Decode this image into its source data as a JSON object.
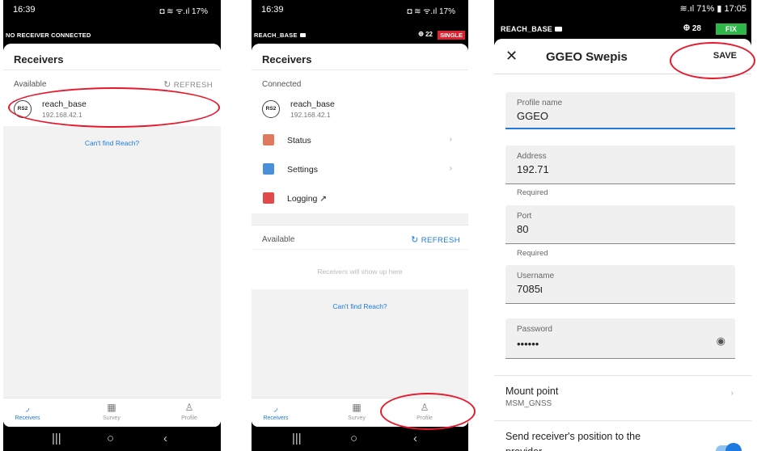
{
  "phone1": {
    "status_time": "16:39",
    "status_icons": "◘ ≋ ᯤ.ıl 17%",
    "connection": "NO RECEIVER CONNECTED",
    "header": "Receivers",
    "available_label": "Available",
    "refresh": "REFRESH",
    "receiver": {
      "badge": "RS2",
      "name": "reach_base",
      "ip": "192.168.42.1"
    },
    "cant_find": "Can't find Reach?",
    "tabs": [
      "Receivers",
      "Survey",
      "Profile"
    ]
  },
  "phone2": {
    "status_time": "16:39",
    "status_icons": "◘ ≋ ᯤ.ıl 17%",
    "connection": "REACH_BASE",
    "satellites": "22",
    "fix_status": "SINGLE",
    "fix_color": "#e0202c",
    "header": "Receivers",
    "connected_label": "Connected",
    "receiver": {
      "badge": "RS2",
      "name": "reach_base",
      "ip": "192.168.42.1"
    },
    "menu": [
      {
        "label": "Status",
        "color": "#e07a5f"
      },
      {
        "label": "Settings",
        "color": "#4a8fd9"
      },
      {
        "label": "Logging ↗",
        "color": "#e04a4a"
      }
    ],
    "available_label": "Available",
    "refresh": "REFRESH",
    "placeholder": "Receivers will show up here",
    "cant_find": "Can't find Reach?",
    "tabs": [
      "Receivers",
      "Survey",
      "Profile"
    ]
  },
  "phone3": {
    "status_icons": "≋.ıl 71% ▮ 17:05",
    "connection": "REACH_BASE",
    "satellites": "28",
    "fix_status": "FIX",
    "fix_color": "#2fb84a",
    "title": "GGEO Swepis",
    "save": "SAVE",
    "fields": {
      "profile_name_label": "Profile name",
      "profile_name_value": "GGEO",
      "address_label": "Address",
      "address_value": "192.71",
      "address_helper": "Required",
      "port_label": "Port",
      "port_value": "80",
      "port_helper": "Required",
      "username_label": "Username",
      "username_value": "7085ι",
      "password_label": "Password",
      "password_value": "••••••"
    },
    "mount_point_label": "Mount point",
    "mount_point_value": "MSM_GNSS",
    "send_position_label": "Send receiver's position to the provider"
  }
}
